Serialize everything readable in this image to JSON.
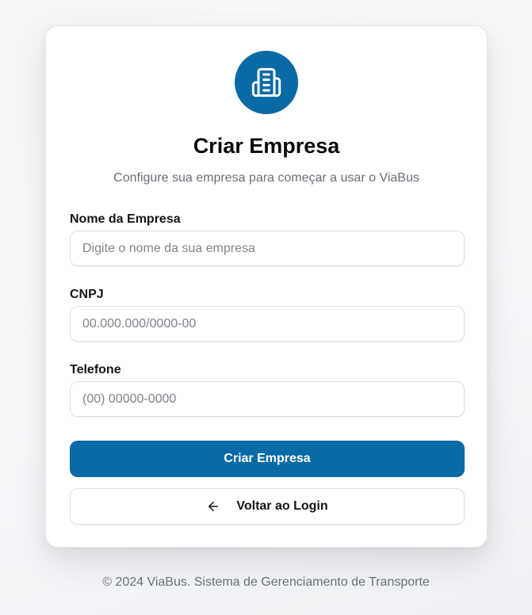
{
  "colors": {
    "brand": "#0a6aa6",
    "muted_text": "#6b6f76",
    "border": "#dcdfe4"
  },
  "header": {
    "logo_icon": "building-icon",
    "title": "Criar Empresa",
    "subtitle": "Configure sua empresa para começar a usar o ViaBus"
  },
  "form": {
    "company_name": {
      "label": "Nome da Empresa",
      "value": "",
      "placeholder": "Digite o nome da sua empresa"
    },
    "cnpj": {
      "label": "CNPJ",
      "value": "",
      "placeholder": "00.000.000/0000-00"
    },
    "phone": {
      "label": "Telefone",
      "value": "",
      "placeholder": "(00) 00000-0000"
    },
    "submit_label": "Criar Empresa",
    "back_label": "Voltar ao Login",
    "back_icon": "arrow-left-icon"
  },
  "footer": {
    "text": "© 2024 ViaBus. Sistema de Gerenciamento de Transporte"
  }
}
